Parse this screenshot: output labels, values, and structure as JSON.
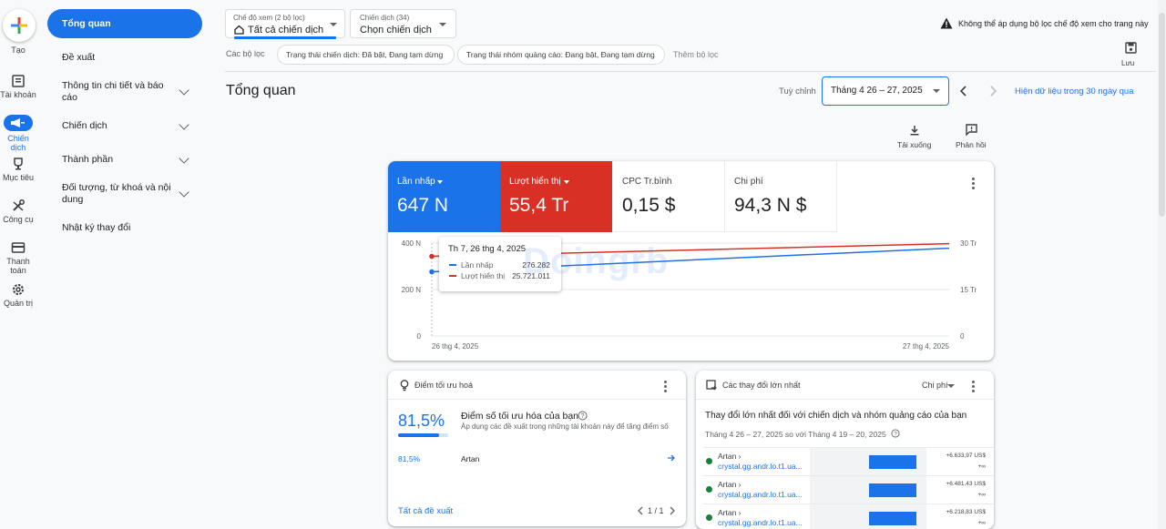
{
  "rail": {
    "create": "Tạo",
    "items": [
      {
        "label": "Tài khoản",
        "icon": "account-icon"
      },
      {
        "label": "Chiến dịch",
        "icon": "campaign-icon"
      },
      {
        "label": "Mục tiêu",
        "icon": "trophy-icon"
      },
      {
        "label": "Công cụ",
        "icon": "tools-icon"
      },
      {
        "label": "Thanh toán",
        "icon": "billing-icon"
      },
      {
        "label": "Quản trị",
        "icon": "admin-icon"
      }
    ]
  },
  "nav": {
    "items": [
      "Tổng quan",
      "Đề xuất",
      "Thông tin chi tiết và báo cáo",
      "Chiến dịch",
      "Thành phần",
      "Đối tượng, từ khoá và nội dung",
      "Nhật ký thay đổi"
    ]
  },
  "filters": {
    "view_label": "Chế độ xem (2 bộ lọc)",
    "view_value": "Tất cả chiến dịch",
    "campaign_label": "Chiến dịch (34)",
    "campaign_value": "Chọn chiến dịch",
    "warning": "Không thể áp dụng bộ lọc chế độ xem cho trang này",
    "filters_label": "Các bộ lọc",
    "chip1": "Trạng thái chiến dịch: Đã bật, Đang tạm dừng",
    "chip2": "Trạng thái nhóm quảng cáo: Đang bật, Đang tạm dừng",
    "add_filter": "Thêm bộ lọc",
    "save": "Lưu"
  },
  "header": {
    "title": "Tổng quan",
    "custom": "Tuỳ chỉnh",
    "date_range": "Tháng 4 26 – 27, 2025",
    "last30": "Hiện dữ liệu trong 30 ngày qua",
    "download": "Tải xuống",
    "feedback": "Phản hồi"
  },
  "metrics": [
    {
      "title": "Lần nhấp",
      "value": "647 N",
      "color": "#1a73e8"
    },
    {
      "title": "Lượt hiển thị",
      "value": "55,4 Tr",
      "color": "#d93025"
    },
    {
      "title": "CPC Tr.bình",
      "value": "0,15 $"
    },
    {
      "title": "Chi phí",
      "value": "94,3 N $"
    }
  ],
  "chart_data": {
    "type": "line",
    "x": [
      "26 thg 4, 2025",
      "27 thg 4, 2025"
    ],
    "series": [
      {
        "name": "Lần nhấp",
        "values": [
          276282,
          378000
        ],
        "color": "#1a73e8",
        "axis": "left"
      },
      {
        "name": "Lượt hiển thị",
        "values": [
          25721011,
          29800000
        ],
        "color": "#d93025",
        "axis": "right"
      }
    ],
    "y_left": {
      "ticks": [
        "400 N",
        "200 N",
        "0"
      ],
      "range": [
        0,
        400000
      ]
    },
    "y_right": {
      "ticks": [
        "30 Tr",
        "15 Tr",
        "0"
      ],
      "range": [
        0,
        30000000
      ]
    },
    "x_ticks": [
      "26 thg 4, 2025",
      "27 thg 4, 2025"
    ]
  },
  "tooltip": {
    "date": "Th 7, 26 thg 4, 2025",
    "row1_label": "Lần nhấp",
    "row1_value": "276.282",
    "row2_label": "Lượt hiển thị",
    "row2_value": "25.721.011"
  },
  "watermark": "Doingrb",
  "optimization": {
    "title": "Điểm tối ưu hoá",
    "score": "81,5%",
    "score_fraction": 0.815,
    "heading": "Điểm số tối ưu hóa của bạn",
    "desc": "Áp dụng các đề xuất trong những tài khoản này để tăng điểm số",
    "row_score": "81,5%",
    "row_name": "Artan",
    "all": "Tất cả đề xuất",
    "pager": "1 / 1"
  },
  "changes": {
    "title": "Các thay đổi lớn nhất",
    "metric": "Chi phí",
    "heading": "Thay đổi lớn nhất đối với chiến dịch và nhóm quảng cáo của bạn",
    "compare": "Tháng 4 26 – 27, 2025 so với Tháng 4 19 – 20, 2025",
    "rows": [
      {
        "name": "Artan ›",
        "link": "crystal.gg.andr.lo.t1.ua...",
        "value": "+6.633,97 US$",
        "sub": "+∞"
      },
      {
        "name": "Artan ›",
        "link": "crystal.gg.andr.lo.t1.ua...",
        "value": "+6.481,43 US$",
        "sub": "+∞"
      },
      {
        "name": "Artan ›",
        "link": "crystal.gg.andr.lo.t1.ua...",
        "value": "+6.218,83 US$",
        "sub": "+∞"
      }
    ]
  }
}
